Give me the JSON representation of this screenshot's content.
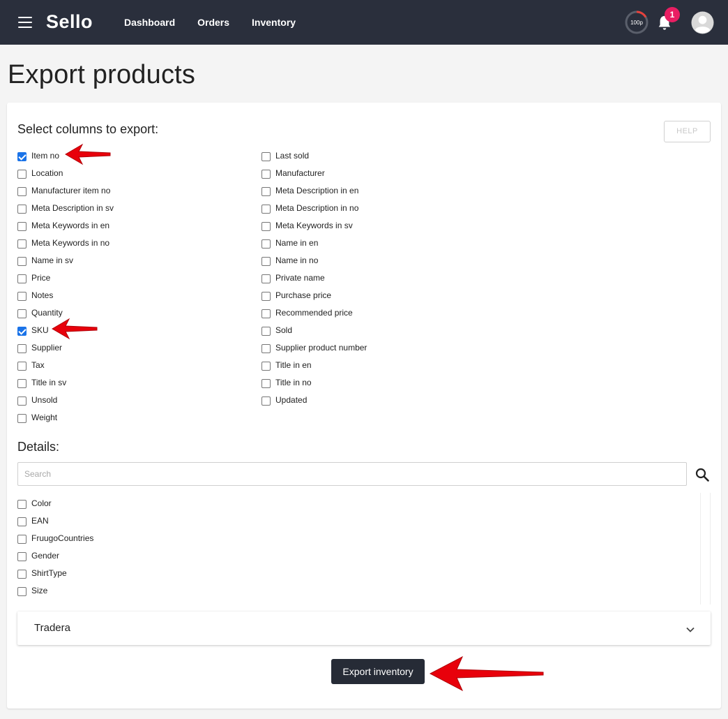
{
  "header": {
    "logo": "Sello",
    "nav": [
      "Dashboard",
      "Orders",
      "Inventory"
    ],
    "gauge_label": "100p",
    "notification_count": "1"
  },
  "page_title": "Export products",
  "columns_section": {
    "title": "Select columns to export:",
    "help_label": "HELP",
    "left": [
      {
        "label": "Item no",
        "checked": true
      },
      {
        "label": "Location",
        "checked": false
      },
      {
        "label": "Manufacturer item no",
        "checked": false
      },
      {
        "label": "Meta Description in sv",
        "checked": false
      },
      {
        "label": "Meta Keywords in en",
        "checked": false
      },
      {
        "label": "Meta Keywords in no",
        "checked": false
      },
      {
        "label": "Name in sv",
        "checked": false
      },
      {
        "label": "Price",
        "checked": false
      },
      {
        "label": "Notes",
        "checked": false
      },
      {
        "label": "Quantity",
        "checked": false
      },
      {
        "label": "SKU",
        "checked": true
      },
      {
        "label": "Supplier",
        "checked": false
      },
      {
        "label": "Tax",
        "checked": false
      },
      {
        "label": "Title in sv",
        "checked": false
      },
      {
        "label": "Unsold",
        "checked": false
      },
      {
        "label": "Weight",
        "checked": false
      }
    ],
    "right": [
      {
        "label": "Last sold",
        "checked": false
      },
      {
        "label": "Manufacturer",
        "checked": false
      },
      {
        "label": "Meta Description in en",
        "checked": false
      },
      {
        "label": "Meta Description in no",
        "checked": false
      },
      {
        "label": "Meta Keywords in sv",
        "checked": false
      },
      {
        "label": "Name in en",
        "checked": false
      },
      {
        "label": "Name in no",
        "checked": false
      },
      {
        "label": "Private name",
        "checked": false
      },
      {
        "label": "Purchase price",
        "checked": false
      },
      {
        "label": "Recommended price",
        "checked": false
      },
      {
        "label": "Sold",
        "checked": false
      },
      {
        "label": "Supplier product number",
        "checked": false
      },
      {
        "label": "Title in en",
        "checked": false
      },
      {
        "label": "Title in no",
        "checked": false
      },
      {
        "label": "Updated",
        "checked": false
      }
    ]
  },
  "details_section": {
    "title": "Details:",
    "search_placeholder": "Search",
    "items": [
      {
        "label": "Color",
        "checked": false
      },
      {
        "label": "EAN",
        "checked": false
      },
      {
        "label": "FruugoCountries",
        "checked": false
      },
      {
        "label": "Gender",
        "checked": false
      },
      {
        "label": "ShirtType",
        "checked": false
      },
      {
        "label": "Size",
        "checked": false
      }
    ]
  },
  "accordion": {
    "title": "Tradera"
  },
  "export_button": "Export inventory",
  "colors": {
    "topbar": "#2a2f3c",
    "badge": "#e91e63",
    "checkbox": "#1a73e8",
    "arrow": "#e8000b"
  }
}
